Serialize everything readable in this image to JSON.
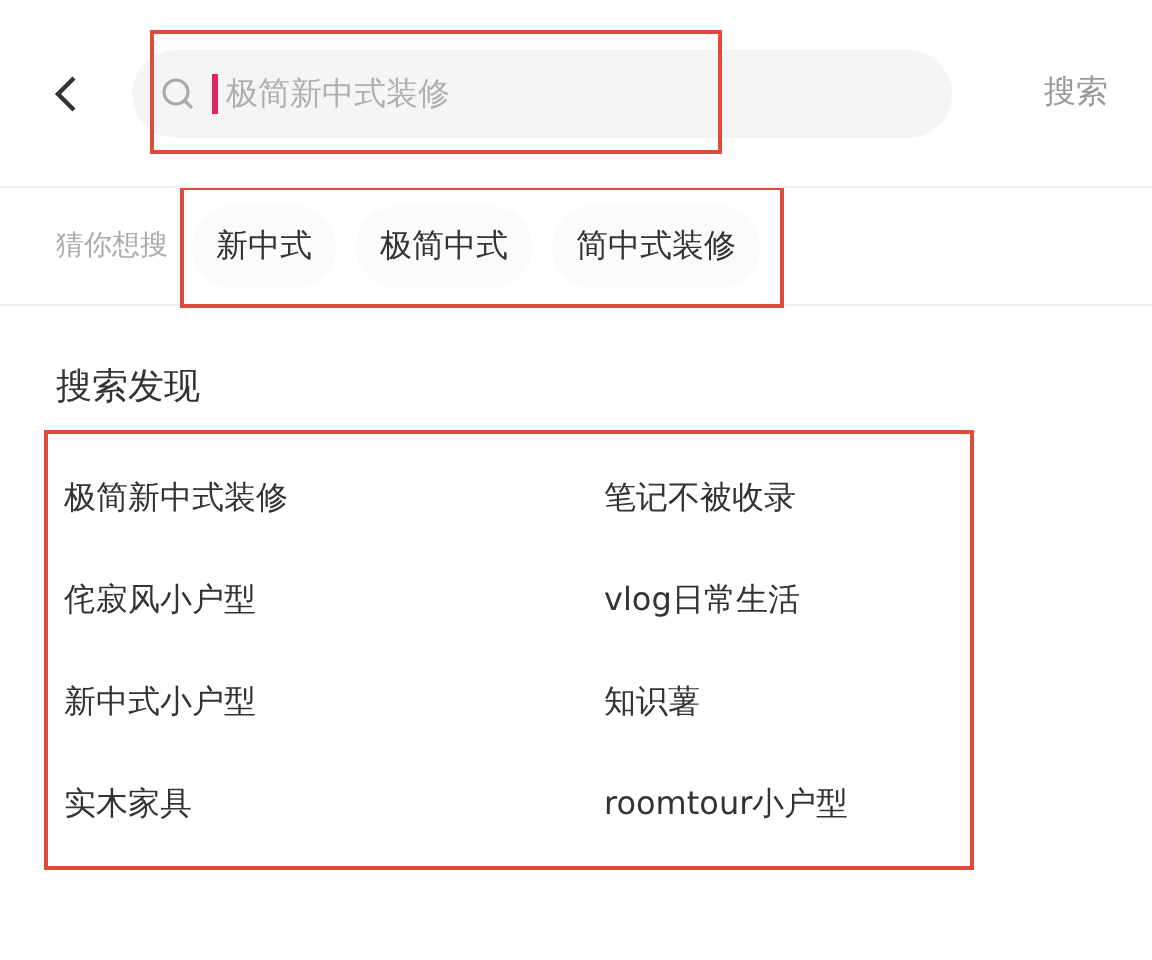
{
  "search": {
    "placeholder": "极简新中式装修",
    "highlighted": true,
    "submit": "搜索"
  },
  "suggestions": {
    "label": "猜你想搜",
    "highlighted": true,
    "items": [
      "新中式",
      "极简中式",
      "简中式装修"
    ]
  },
  "discover": {
    "title": "搜索发现",
    "highlighted": true,
    "items": [
      "极简新中式装修",
      "笔记不被收录",
      "侘寂风小户型",
      "vlog日常生活",
      "新中式小户型",
      "知识薯",
      "实木家具",
      "roomtour小户型"
    ]
  }
}
